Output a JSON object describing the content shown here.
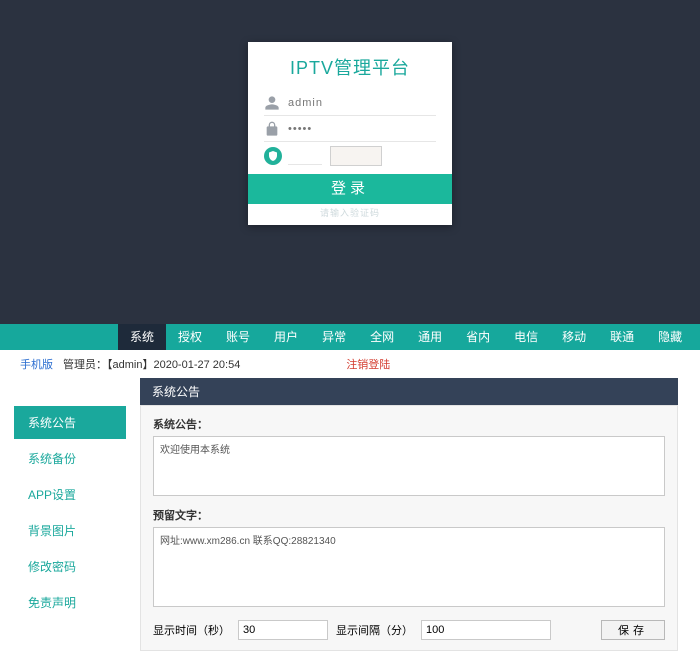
{
  "login": {
    "title": "IPTV管理平台",
    "username_value": "admin",
    "password_value": "·····",
    "captcha_text": "",
    "button_label": "登录",
    "ghost_text": "请输入验证码"
  },
  "nav": {
    "items": [
      {
        "label": "系统",
        "active": true
      },
      {
        "label": "授权",
        "active": false
      },
      {
        "label": "账号",
        "active": false
      },
      {
        "label": "用户",
        "active": false
      },
      {
        "label": "异常",
        "active": false
      },
      {
        "label": "全网",
        "active": false
      },
      {
        "label": "通用",
        "active": false
      },
      {
        "label": "省内",
        "active": false
      },
      {
        "label": "电信",
        "active": false
      },
      {
        "label": "移动",
        "active": false
      },
      {
        "label": "联通",
        "active": false
      },
      {
        "label": "隐藏",
        "active": false
      }
    ]
  },
  "infobar": {
    "mobile": "手机版",
    "admin_label": "管理员：【admin】2020-01-27 20:54",
    "logout": "注销登陆"
  },
  "sidemenu": {
    "items": [
      {
        "label": "系统公告",
        "active": true
      },
      {
        "label": "系统备份",
        "active": false
      },
      {
        "label": "APP设置",
        "active": false
      },
      {
        "label": "背景图片",
        "active": false
      },
      {
        "label": "修改密码",
        "active": false
      },
      {
        "label": "免责声明",
        "active": false
      }
    ]
  },
  "panel": {
    "header": "系统公告",
    "field1_label": "系统公告：",
    "field1_value": "欢迎使用本系统",
    "field2_label": "预留文字：",
    "field2_value": "网址:www.xm286.cn 联系QQ:28821340",
    "time_label": "显示时间（秒）",
    "time_value": "30",
    "interval_label": "显示间隔（分）",
    "interval_value": "100",
    "save_label": "保存"
  }
}
